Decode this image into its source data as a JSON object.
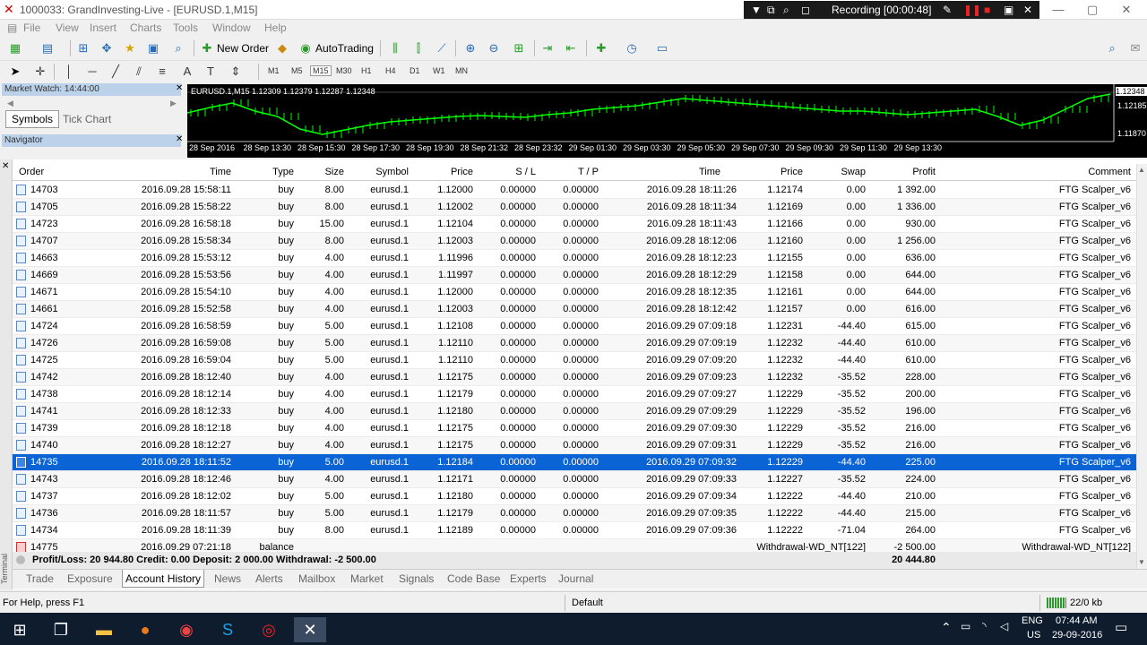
{
  "window": {
    "title": "1000033: GrandInvesting-Live - [EURUSD.1,M15]"
  },
  "recording": {
    "label": "Recording [00:00:48]"
  },
  "menu": [
    "File",
    "View",
    "Insert",
    "Charts",
    "Tools",
    "Window",
    "Help"
  ],
  "toolbar": {
    "new_order": "New Order",
    "autotrading": "AutoTrading"
  },
  "timeframes": [
    "M1",
    "M5",
    "M15",
    "M30",
    "H1",
    "H4",
    "D1",
    "W1",
    "MN"
  ],
  "market_watch": {
    "title": "Market Watch: 14:44:00",
    "tabs": [
      "Symbols",
      "Tick Chart"
    ]
  },
  "navigator": {
    "title": "Navigator"
  },
  "chart": {
    "label": "EURUSD.1,M15  1.12309 1.12379 1.12287 1.12348",
    "prices": [
      "1.12348",
      "1.12185",
      "1.11870"
    ],
    "times": [
      "28 Sep 2016",
      "28 Sep 13:30",
      "28 Sep 15:30",
      "28 Sep 17:30",
      "28 Sep 19:30",
      "28 Sep 21:32",
      "28 Sep 23:32",
      "29 Sep 01:30",
      "29 Sep 03:30",
      "29 Sep 05:30",
      "29 Sep 07:30",
      "29 Sep 09:30",
      "29 Sep 11:30",
      "29 Sep 13:30"
    ]
  },
  "table": {
    "headers": [
      "Order",
      "Time",
      "Type",
      "Size",
      "Symbol",
      "Price",
      "S / L",
      "T / P",
      "Time",
      "Price",
      "Swap",
      "Profit",
      "Comment"
    ],
    "rows": [
      [
        "14703",
        "2016.09.28 15:58:11",
        "buy",
        "8.00",
        "eurusd.1",
        "1.12000",
        "0.00000",
        "0.00000",
        "2016.09.28 18:11:26",
        "1.12174",
        "0.00",
        "1 392.00",
        "FTG Scalper_v6"
      ],
      [
        "14705",
        "2016.09.28 15:58:22",
        "buy",
        "8.00",
        "eurusd.1",
        "1.12002",
        "0.00000",
        "0.00000",
        "2016.09.28 18:11:34",
        "1.12169",
        "0.00",
        "1 336.00",
        "FTG Scalper_v6"
      ],
      [
        "14723",
        "2016.09.28 16:58:18",
        "buy",
        "15.00",
        "eurusd.1",
        "1.12104",
        "0.00000",
        "0.00000",
        "2016.09.28 18:11:43",
        "1.12166",
        "0.00",
        "930.00",
        "FTG Scalper_v6"
      ],
      [
        "14707",
        "2016.09.28 15:58:34",
        "buy",
        "8.00",
        "eurusd.1",
        "1.12003",
        "0.00000",
        "0.00000",
        "2016.09.28 18:12:06",
        "1.12160",
        "0.00",
        "1 256.00",
        "FTG Scalper_v6"
      ],
      [
        "14663",
        "2016.09.28 15:53:12",
        "buy",
        "4.00",
        "eurusd.1",
        "1.11996",
        "0.00000",
        "0.00000",
        "2016.09.28 18:12:23",
        "1.12155",
        "0.00",
        "636.00",
        "FTG Scalper_v6"
      ],
      [
        "14669",
        "2016.09.28 15:53:56",
        "buy",
        "4.00",
        "eurusd.1",
        "1.11997",
        "0.00000",
        "0.00000",
        "2016.09.28 18:12:29",
        "1.12158",
        "0.00",
        "644.00",
        "FTG Scalper_v6"
      ],
      [
        "14671",
        "2016.09.28 15:54:10",
        "buy",
        "4.00",
        "eurusd.1",
        "1.12000",
        "0.00000",
        "0.00000",
        "2016.09.28 18:12:35",
        "1.12161",
        "0.00",
        "644.00",
        "FTG Scalper_v6"
      ],
      [
        "14661",
        "2016.09.28 15:52:58",
        "buy",
        "4.00",
        "eurusd.1",
        "1.12003",
        "0.00000",
        "0.00000",
        "2016.09.28 18:12:42",
        "1.12157",
        "0.00",
        "616.00",
        "FTG Scalper_v6"
      ],
      [
        "14724",
        "2016.09.28 16:58:59",
        "buy",
        "5.00",
        "eurusd.1",
        "1.12108",
        "0.00000",
        "0.00000",
        "2016.09.29 07:09:18",
        "1.12231",
        "-44.40",
        "615.00",
        "FTG Scalper_v6"
      ],
      [
        "14726",
        "2016.09.28 16:59:08",
        "buy",
        "5.00",
        "eurusd.1",
        "1.12110",
        "0.00000",
        "0.00000",
        "2016.09.29 07:09:19",
        "1.12232",
        "-44.40",
        "610.00",
        "FTG Scalper_v6"
      ],
      [
        "14725",
        "2016.09.28 16:59:04",
        "buy",
        "5.00",
        "eurusd.1",
        "1.12110",
        "0.00000",
        "0.00000",
        "2016.09.29 07:09:20",
        "1.12232",
        "-44.40",
        "610.00",
        "FTG Scalper_v6"
      ],
      [
        "14742",
        "2016.09.28 18:12:40",
        "buy",
        "4.00",
        "eurusd.1",
        "1.12175",
        "0.00000",
        "0.00000",
        "2016.09.29 07:09:23",
        "1.12232",
        "-35.52",
        "228.00",
        "FTG Scalper_v6"
      ],
      [
        "14738",
        "2016.09.28 18:12:14",
        "buy",
        "4.00",
        "eurusd.1",
        "1.12179",
        "0.00000",
        "0.00000",
        "2016.09.29 07:09:27",
        "1.12229",
        "-35.52",
        "200.00",
        "FTG Scalper_v6"
      ],
      [
        "14741",
        "2016.09.28 18:12:33",
        "buy",
        "4.00",
        "eurusd.1",
        "1.12180",
        "0.00000",
        "0.00000",
        "2016.09.29 07:09:29",
        "1.12229",
        "-35.52",
        "196.00",
        "FTG Scalper_v6"
      ],
      [
        "14739",
        "2016.09.28 18:12:18",
        "buy",
        "4.00",
        "eurusd.1",
        "1.12175",
        "0.00000",
        "0.00000",
        "2016.09.29 07:09:30",
        "1.12229",
        "-35.52",
        "216.00",
        "FTG Scalper_v6"
      ],
      [
        "14740",
        "2016.09.28 18:12:27",
        "buy",
        "4.00",
        "eurusd.1",
        "1.12175",
        "0.00000",
        "0.00000",
        "2016.09.29 07:09:31",
        "1.12229",
        "-35.52",
        "216.00",
        "FTG Scalper_v6"
      ],
      [
        "14735",
        "2016.09.28 18:11:52",
        "buy",
        "5.00",
        "eurusd.1",
        "1.12184",
        "0.00000",
        "0.00000",
        "2016.09.29 07:09:32",
        "1.12229",
        "-44.40",
        "225.00",
        "FTG Scalper_v6"
      ],
      [
        "14743",
        "2016.09.28 18:12:46",
        "buy",
        "4.00",
        "eurusd.1",
        "1.12171",
        "0.00000",
        "0.00000",
        "2016.09.29 07:09:33",
        "1.12227",
        "-35.52",
        "224.00",
        "FTG Scalper_v6"
      ],
      [
        "14737",
        "2016.09.28 18:12:02",
        "buy",
        "5.00",
        "eurusd.1",
        "1.12180",
        "0.00000",
        "0.00000",
        "2016.09.29 07:09:34",
        "1.12222",
        "-44.40",
        "210.00",
        "FTG Scalper_v6"
      ],
      [
        "14736",
        "2016.09.28 18:11:57",
        "buy",
        "5.00",
        "eurusd.1",
        "1.12179",
        "0.00000",
        "0.00000",
        "2016.09.29 07:09:35",
        "1.12222",
        "-44.40",
        "215.00",
        "FTG Scalper_v6"
      ],
      [
        "14734",
        "2016.09.28 18:11:39",
        "buy",
        "8.00",
        "eurusd.1",
        "1.12189",
        "0.00000",
        "0.00000",
        "2016.09.29 07:09:36",
        "1.12222",
        "-71.04",
        "264.00",
        "FTG Scalper_v6"
      ]
    ],
    "balance_row": {
      "order": "14775",
      "time": "2016.09.29 07:21:18",
      "type": "balance",
      "note": "Withdrawal-WD_NT[122]",
      "profit": "-2 500.00",
      "comment": "Withdrawal-WD_NT[122]"
    },
    "summary": {
      "text": "Profit/Loss: 20 944.80  Credit: 0.00  Deposit: 2 000.00  Withdrawal: -2 500.00",
      "total": "20 444.80"
    }
  },
  "tabs": [
    "Trade",
    "Exposure",
    "Account History",
    "News",
    "Alerts",
    "Mailbox",
    "Market",
    "Signals",
    "Code Base",
    "Experts",
    "Journal"
  ],
  "status": {
    "help": "For Help, press F1",
    "profile": "Default",
    "traffic": "22/0 kb"
  },
  "taskbar": {
    "lang1": "ENG",
    "lang2": "US",
    "time": "07:44 AM",
    "date": "29-09-2016"
  },
  "colors": {
    "selected_row": "#0a64d6",
    "candle": "#00ff00",
    "chart_bg": "#000000"
  }
}
